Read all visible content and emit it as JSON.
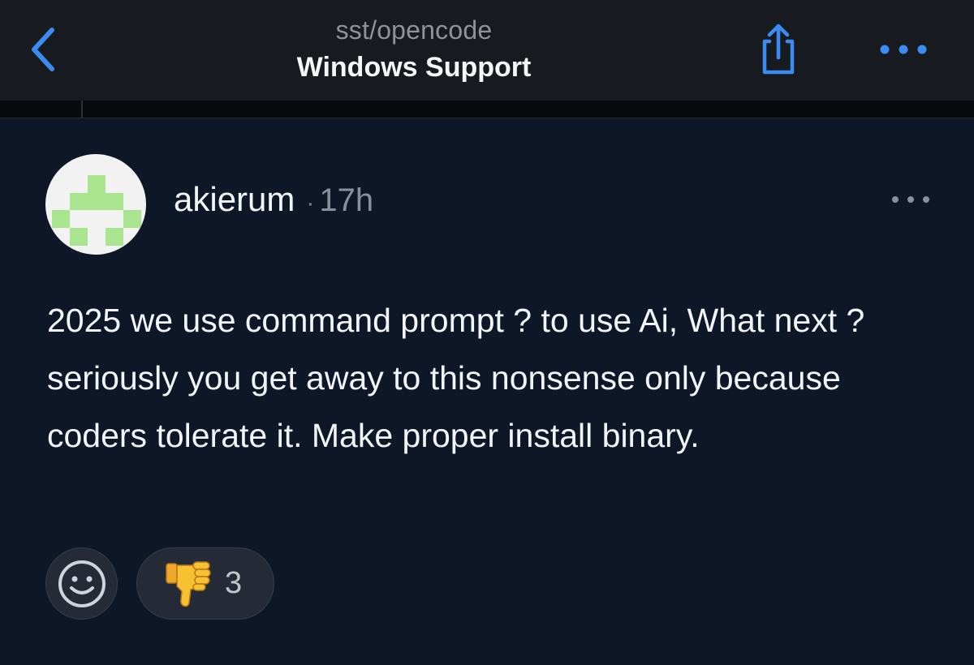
{
  "nav": {
    "back_icon": "chevron-left-icon",
    "repo": "sst/opencode",
    "title": "Windows Support",
    "share_icon": "share-icon",
    "more_icon": "ellipsis-icon"
  },
  "comment": {
    "avatar_icon": "identicon-avatar",
    "author": "akierum",
    "separator": "·",
    "time": "17h",
    "more_icon": "ellipsis-icon",
    "body": "2025 we use command prompt ? to use Ai, What next ? seriously you get away to this nonsense only because coders tolerate it. Make proper install binary."
  },
  "reactions": {
    "add_icon": "smiley-icon",
    "items": [
      {
        "emoji": "thumbs-down-icon",
        "count": "3"
      }
    ]
  },
  "colors": {
    "background": "#0d1727",
    "navbar": "#171a1e",
    "accent": "#3a8cf2",
    "avatar_green": "#a8e58e"
  }
}
